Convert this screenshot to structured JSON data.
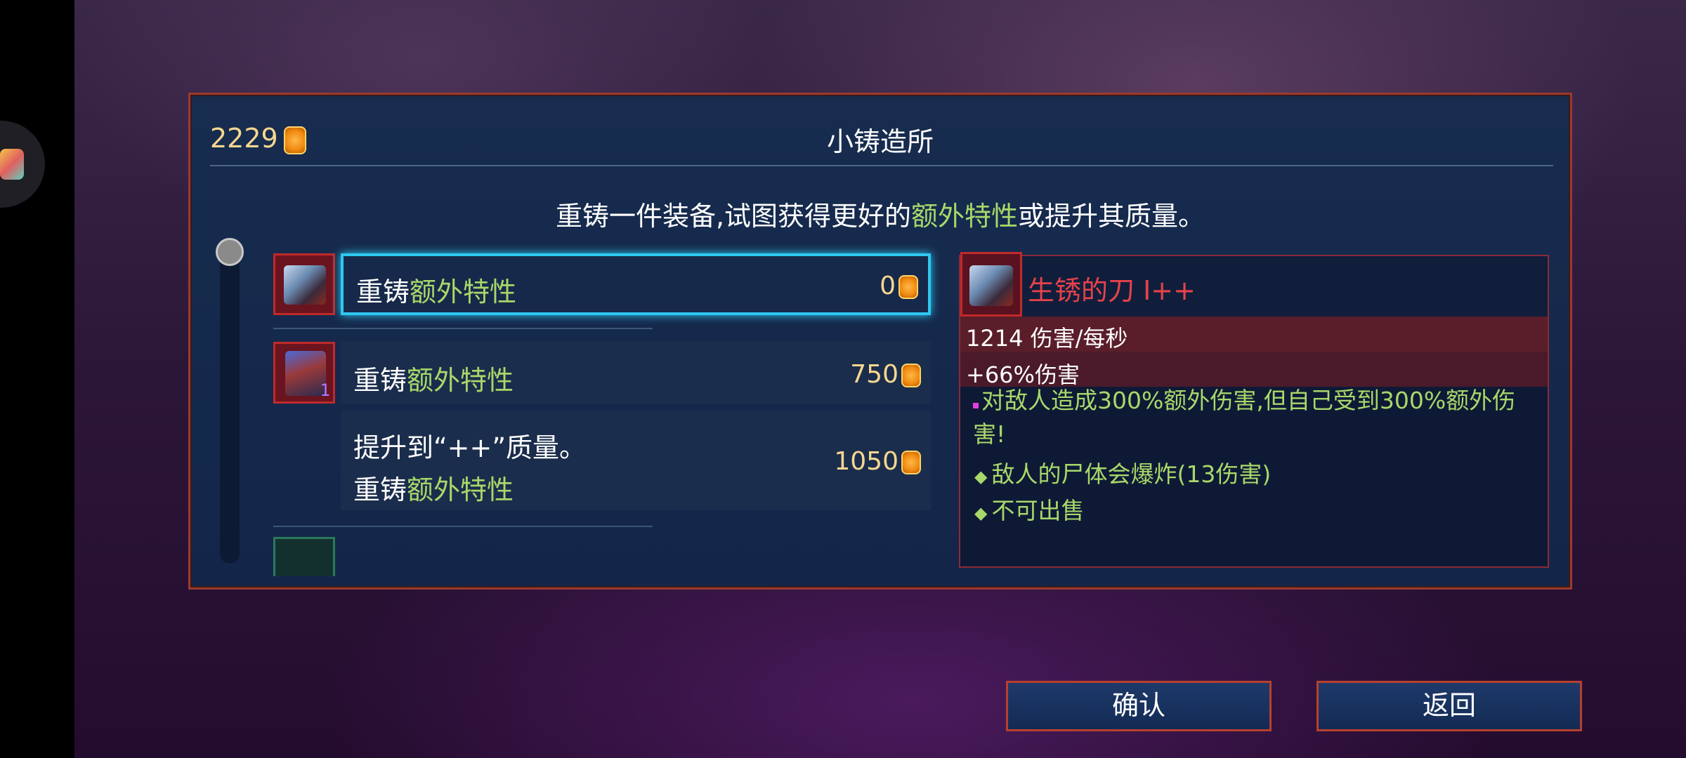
{
  "currency": {
    "amount": "2229",
    "icon": "gold-coin-icon"
  },
  "window": {
    "title": "小铸造所",
    "subtitle_prefix": "重铸一件装备,试图获得更好的",
    "subtitle_highlight": "额外特性",
    "subtitle_suffix": "或提升其质量。"
  },
  "options": [
    {
      "label_prefix": "重铸",
      "label_highlight": "额外特性",
      "price": "0",
      "selected": true
    },
    {
      "label_prefix": "重铸",
      "label_highlight": "额外特性",
      "price": "750",
      "selected": false
    },
    {
      "line1": "提升到“++”质量。",
      "label_prefix": "重铸",
      "label_highlight": "额外特性",
      "price": "1050",
      "selected": false
    }
  ],
  "items": [
    {
      "icon": "rusty-sword-icon"
    },
    {
      "icon": "boots-icon",
      "badge": "1"
    },
    {
      "icon": "armor-icon"
    }
  ],
  "tooltip": {
    "name": "生锈的刀 I++",
    "dps": "1214 伤害/每秒",
    "bonus": "+66%伤害",
    "description": "对敌人造成300%额外伤害,但自己受到300%额外伤害!",
    "traits": [
      "敌人的尸体会爆炸(13伤害)",
      "不可出售"
    ]
  },
  "buttons": {
    "confirm": "确认",
    "back": "返回"
  },
  "colors": {
    "accent_green": "#a8d86a",
    "gold": "#f6d790",
    "selection_cyan": "#2ec8f0",
    "item_name_red": "#e8424a"
  }
}
